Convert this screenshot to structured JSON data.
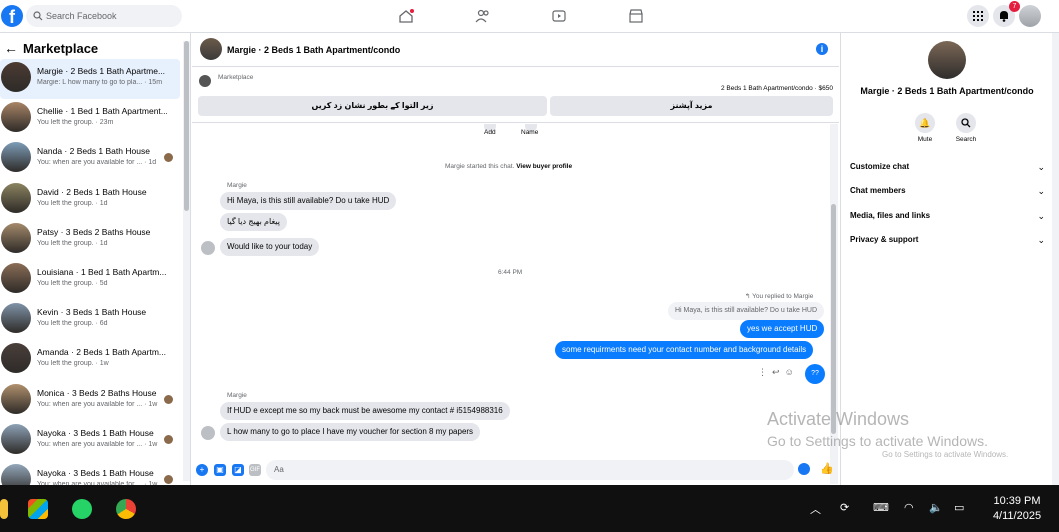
{
  "topbar": {
    "logo": "f",
    "search_placeholder": "Search Facebook",
    "notification_count": "7"
  },
  "left": {
    "title": "Marketplace",
    "back_glyph": "←",
    "chats": [
      {
        "name": "Margie · 2 Beds 1 Bath Apartme...",
        "sub": "Margie: L how many to go to pla... · 15m",
        "color": "#4b3b33",
        "active": true
      },
      {
        "name": "Chellie · 1 Bed 1 Bath Apartment...",
        "sub": "You left the group. · 23m",
        "color": "#a88466"
      },
      {
        "name": "Nanda · 2 Beds 1 Bath House",
        "sub": "You: when are you available for ... · 1d",
        "color": "#7d9db8",
        "mini": true
      },
      {
        "name": "David · 2 Beds 1 Bath House",
        "sub": "You left the group. · 1d",
        "color": "#8b8360"
      },
      {
        "name": "Patsy · 3 Beds 2 Baths House",
        "sub": "You left the group. · 1d",
        "color": "#a48a6b"
      },
      {
        "name": "Louisiana · 1 Bed 1 Bath Apartm...",
        "sub": "You left the group. · 5d",
        "color": "#8a6d56"
      },
      {
        "name": "Kevin · 3 Beds 1 Bath House",
        "sub": "You left the group. · 6d",
        "color": "#7f93a8"
      },
      {
        "name": "Amanda · 2 Beds 1 Bath Apartm...",
        "sub": "You left the group. · 1w",
        "color": "#4a3f3a"
      },
      {
        "name": "Monica · 3 Beds 2 Baths House",
        "sub": "You: when are you available for ... · 1w",
        "color": "#b0906d",
        "mini": true
      },
      {
        "name": "Nayoka · 3 Beds 1 Bath House",
        "sub": "You: when are you available for ... · 1w",
        "color": "#8da2b7",
        "mini": true
      },
      {
        "name": "Nayoka · 3 Beds 1 Bath House",
        "sub": "You: when are you available for ... · 1w",
        "color": "#93a7ba",
        "mini": true
      }
    ]
  },
  "chat": {
    "header_title": "Margie · 2 Beds 1 Bath Apartment/condo",
    "marketplace_label": "Marketplace",
    "listing_price": "2 Beds 1 Bath Apartment/condo · $650",
    "btn_mark": "زیر التوا کے بطور نشان زد کریں",
    "btn_more": "مزید آپشنز",
    "add_label": "Add",
    "name_label": "Name",
    "started_text": "Margie started this chat.",
    "view_profile": "View buyer profile",
    "sender1": "Margie",
    "in1": "Hi Maya, is this still available? Do u take HUD",
    "in2": "پیغام بھیج دیا گیا",
    "in3": "Would like to your today",
    "time": "6:44 PM",
    "reply_note": "You replied to Margie",
    "quote": "Hi Maya, is this still available? Do u take HUD",
    "out1": "yes we accept HUD",
    "out2": "some requirments need your contact number and background details",
    "reply_q": "??",
    "sender2": "Margie",
    "in4": "If HUD e except  me so my back must be awesome my contact # i5154988316",
    "in5": "L how many to go to place I have my voucher for section 8 my papers",
    "composer_placeholder": "Aa"
  },
  "right": {
    "name": "Margie · 2 Beds 1 Bath Apartment/condo",
    "mute": "Mute",
    "search": "Search",
    "menu": [
      "Customize chat",
      "Chat members",
      "Media, files and links",
      "Privacy & support"
    ]
  },
  "watermark": {
    "line1": "Activate Windows",
    "line2": "Go to Settings to activate Windows.",
    "line3": "Go to Settings to activate Windows."
  },
  "taskbar": {
    "time": "10:39 PM",
    "date": "4/11/2025"
  }
}
